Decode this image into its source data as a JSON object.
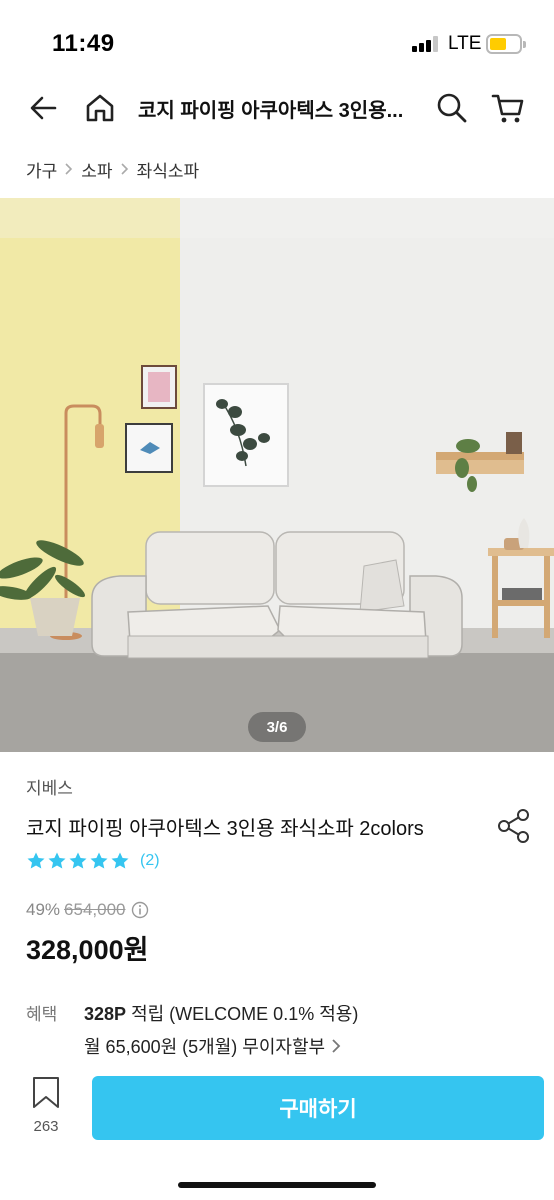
{
  "status_bar": {
    "time": "11:49",
    "network": "LTE",
    "battery_level": 0.45,
    "signal_bars": 3,
    "signal_max": 4
  },
  "nav": {
    "title": "코지 파이핑 아쿠아텍스 3인용...",
    "icons": [
      "back-arrow-icon",
      "home-icon",
      "search-icon",
      "cart-icon"
    ]
  },
  "breadcrumb": [
    "가구",
    "소파",
    "좌식소파"
  ],
  "gallery": {
    "indicator": "3/6",
    "current": 3,
    "total": 6
  },
  "product": {
    "brand": "지베스",
    "title": "코지 파이핑 아쿠아텍스 3인용 좌식소파 2colors",
    "rating": 5,
    "rating_max": 5,
    "review_count": "(2)",
    "discount_rate": "49%",
    "original_price": "654,000",
    "sale_price": "328,000원"
  },
  "benefits": {
    "label": "혜택",
    "point_amount": "328P",
    "point_text": "적립 (WELCOME 0.1% 적용)",
    "installment": "월 65,600원 (5개월) 무이자할부"
  },
  "bottom_bar": {
    "scrap_count": "263",
    "buy_label": "구매하기"
  },
  "colors": {
    "accent": "#35c5f0",
    "text": "#222222",
    "muted": "#888888"
  }
}
